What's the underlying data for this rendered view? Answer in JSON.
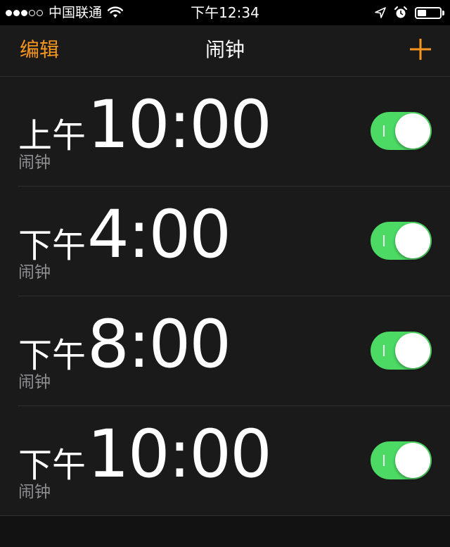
{
  "status_bar": {
    "signal_dots": [
      "full",
      "full",
      "full",
      "empty",
      "empty"
    ],
    "carrier": "中国联通",
    "wifi_icon": "wifi-icon",
    "time": "下午12:34",
    "location_icon": "location-arrow-icon",
    "alarm_icon": "alarm-clock-icon",
    "battery_level": 0.4
  },
  "nav": {
    "edit_label": "编辑",
    "title": "闹钟",
    "add_icon": "plus-icon"
  },
  "alarms": [
    {
      "ampm": "上午",
      "time": "10:00",
      "label": "闹钟",
      "enabled": true
    },
    {
      "ampm": "下午",
      "time": "4:00",
      "label": "闹钟",
      "enabled": true
    },
    {
      "ampm": "下午",
      "time": "8:00",
      "label": "闹钟",
      "enabled": true
    },
    {
      "ampm": "下午",
      "time": "10:00",
      "label": "闹钟",
      "enabled": true
    }
  ],
  "colors": {
    "accent": "#f7961d",
    "toggle_on": "#4cd964",
    "label_gray": "#8e8e93",
    "background": "#1a1a1a"
  }
}
